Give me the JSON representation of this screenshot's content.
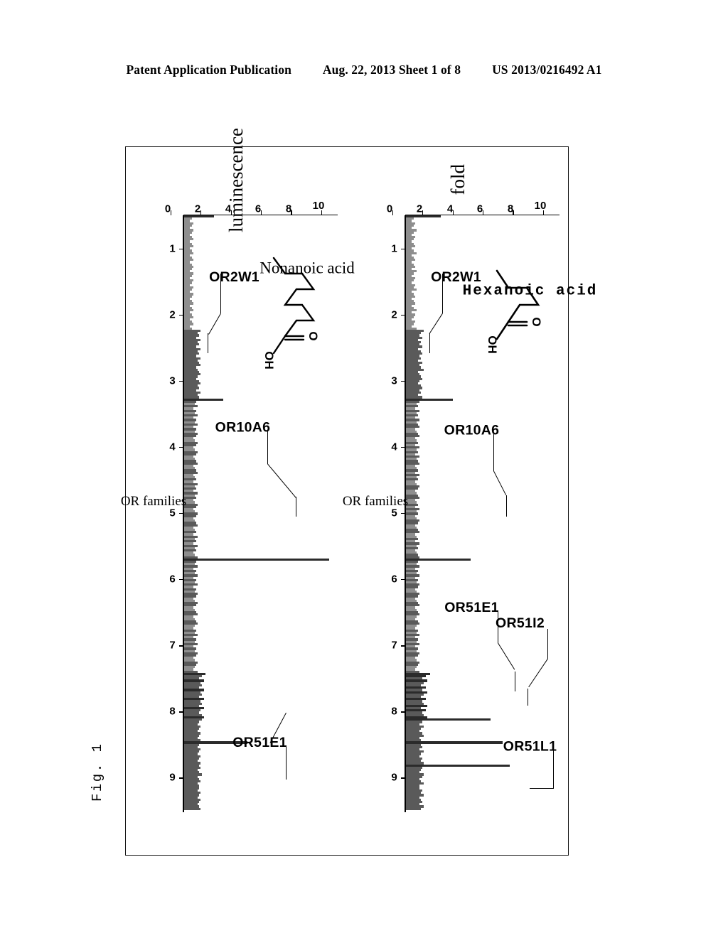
{
  "header": {
    "publication": "Patent Application Publication",
    "date_sheet": "Aug. 22, 2013  Sheet 1 of 8",
    "patent_number": "US 2013/0216492 A1"
  },
  "figure": {
    "label": "Fig. 1"
  },
  "axes": {
    "y_ticks": [
      "0",
      "2",
      "4",
      "6",
      "8",
      "10"
    ],
    "x_ticks": [
      "1",
      "2",
      "3",
      "4",
      "5",
      "6",
      "7",
      "8",
      "9"
    ],
    "x_title": "OR families",
    "y_title_part1": "fold",
    "y_title_part2": "luminescence"
  },
  "panels": [
    {
      "id": "hexanoic",
      "compound": "Hexanoic acid",
      "compound_font": "mono",
      "structure": {
        "carbonyl_label": "O",
        "hydroxyl_label": "OH",
        "chain_carbons": 6
      },
      "callouts": [
        {
          "label": "OR2W1"
        },
        {
          "label": "OR10A6"
        },
        {
          "label": "OR51E1"
        },
        {
          "label": "OR51I2"
        },
        {
          "label": "OR51L1"
        }
      ]
    },
    {
      "id": "nonanoic",
      "compound": "Nonanoic acid",
      "compound_font": "serif",
      "structure": {
        "carbonyl_label": "O",
        "hydroxyl_label": "OH",
        "chain_carbons": 9
      },
      "callouts": [
        {
          "label": "OR2W1"
        },
        {
          "label": "OR10A6"
        },
        {
          "label": "OR51E1"
        }
      ]
    }
  ],
  "chart_data": [
    {
      "type": "bar",
      "title": "Hexanoic acid",
      "xlabel": "OR families",
      "ylabel": "fold luminescence",
      "ylim": [
        0,
        10
      ],
      "xlim": [
        1,
        9
      ],
      "grid": false,
      "x_ticks": [
        1,
        2,
        3,
        4,
        5,
        6,
        7,
        8,
        9
      ],
      "y_ticks": [
        0,
        2,
        4,
        6,
        8,
        10
      ],
      "annotations": [
        {
          "label": "OR2W1",
          "x": 2.1,
          "y": 3.1
        },
        {
          "label": "OR10A6",
          "x": 5.0,
          "y": 4.3
        },
        {
          "label": "OR51E1",
          "x": 7.6,
          "y": 5.6
        },
        {
          "label": "OR51I2",
          "x": 7.8,
          "y": 6.4
        },
        {
          "label": "OR51L1",
          "x": 8.0,
          "y": 6.9
        }
      ],
      "values": [
        2.3,
        0.5,
        0.4,
        0.6,
        0.5,
        0.4,
        0.7,
        0.5,
        0.4,
        0.6,
        0.5,
        0.4,
        0.5,
        0.6,
        0.4,
        0.5,
        0.7,
        0.4,
        0.5,
        0.6,
        0.4,
        0.5,
        0.6,
        0.4,
        0.7,
        0.5,
        0.4,
        0.6,
        0.5,
        0.4,
        0.6,
        0.5,
        0.7,
        0.4,
        0.5,
        0.6,
        0.4,
        0.5,
        0.6,
        0.4,
        0.5,
        0.7,
        0.4,
        0.6,
        0.5,
        0.4,
        0.6,
        0.5,
        0.4,
        0.7,
        1.2,
        1.0,
        0.9,
        1.1,
        0.8,
        1.0,
        0.9,
        1.1,
        0.8,
        1.0,
        1.1,
        0.9,
        1.0,
        0.8,
        1.1,
        0.9,
        1.0,
        1.2,
        0.8,
        0.9,
        1.0,
        1.1,
        0.9,
        0.8,
        1.0,
        1.1,
        0.9,
        1.0,
        0.8,
        1.1,
        3.1,
        0.9,
        0.7,
        0.8,
        0.6,
        0.9,
        0.7,
        0.8,
        0.6,
        0.9,
        0.7,
        0.8,
        0.9,
        0.6,
        0.7,
        0.8,
        0.9,
        0.6,
        0.7,
        0.8,
        0.6,
        0.9,
        0.7,
        0.8,
        0.6,
        0.9,
        0.7,
        0.8,
        0.9,
        0.6,
        0.7,
        0.8,
        0.6,
        0.9,
        0.7,
        0.8,
        0.6,
        0.7,
        0.9,
        0.8,
        0.6,
        0.7,
        0.8,
        0.9,
        0.6,
        0.7,
        0.8,
        0.6,
        0.9,
        0.7,
        0.8,
        0.6,
        0.7,
        0.9,
        0.8,
        0.6,
        0.7,
        0.8,
        0.9,
        0.6,
        0.7,
        0.8,
        0.6,
        0.9,
        0.7,
        0.8,
        0.6,
        0.7,
        0.8,
        0.9,
        4.3,
        0.8,
        0.7,
        0.9,
        0.6,
        0.8,
        0.7,
        0.9,
        0.6,
        0.8,
        0.7,
        0.9,
        0.8,
        0.6,
        0.7,
        0.9,
        0.8,
        0.6,
        0.7,
        0.8,
        0.9,
        0.6,
        0.7,
        0.8,
        0.9,
        0.7,
        0.6,
        0.8,
        0.9,
        0.7,
        0.6,
        0.8,
        0.7,
        0.9,
        0.6,
        0.8,
        0.7,
        0.9,
        0.6,
        0.8,
        0.7,
        0.9,
        0.8,
        0.6,
        0.7,
        0.9,
        0.8,
        0.7,
        0.6,
        0.9,
        1.6,
        1.3,
        1.1,
        1.4,
        1.2,
        1.0,
        1.3,
        1.1,
        1.4,
        1.2,
        1.0,
        1.3,
        1.1,
        1.2,
        1.4,
        1.0,
        1.3,
        1.1,
        1.2,
        1.4,
        5.6,
        1.1,
        0.9,
        1.2,
        1.0,
        0.9,
        1.1,
        1.2,
        0.9,
        1.0,
        6.4,
        1.0,
        1.1,
        0.9,
        1.2,
        1.0,
        0.9,
        1.1,
        1.0,
        1.2,
        6.9,
        1.1,
        1.0,
        0.9,
        1.2,
        1.1,
        0.9,
        1.0,
        1.2,
        0.9,
        0.9,
        1.1,
        1.0,
        1.2,
        0.9,
        1.0,
        1.1,
        0.9,
        1.2,
        1.0
      ]
    },
    {
      "type": "bar",
      "title": "Nonanoic acid",
      "xlabel": "OR families",
      "ylabel": "fold luminescence",
      "ylim": [
        0,
        10
      ],
      "xlim": [
        1,
        9
      ],
      "grid": false,
      "x_ticks": [
        1,
        2,
        3,
        4,
        5,
        6,
        7,
        8,
        9
      ],
      "y_ticks": [
        0,
        2,
        4,
        6,
        8,
        10
      ],
      "annotations": [
        {
          "label": "OR2W1",
          "x": 2.1,
          "y": 2.6
        },
        {
          "label": "OR10A6",
          "x": 5.0,
          "y": 9.6
        },
        {
          "label": "OR51E1",
          "x": 7.8,
          "y": 4.2
        }
      ],
      "values": [
        2.0,
        0.5,
        0.4,
        0.6,
        0.5,
        0.4,
        0.6,
        0.5,
        0.4,
        0.5,
        0.6,
        0.4,
        0.5,
        0.6,
        0.4,
        0.5,
        0.6,
        0.4,
        0.5,
        0.6,
        0.4,
        0.5,
        0.6,
        0.5,
        0.4,
        0.6,
        0.5,
        0.4,
        0.6,
        0.5,
        0.4,
        0.6,
        0.5,
        0.4,
        0.6,
        0.5,
        0.4,
        0.5,
        0.6,
        0.4,
        0.5,
        0.6,
        0.4,
        0.5,
        0.6,
        0.4,
        0.5,
        0.6,
        0.4,
        0.5,
        1.1,
        0.9,
        1.0,
        0.8,
        1.1,
        0.9,
        1.0,
        0.8,
        1.1,
        0.9,
        1.0,
        0.8,
        1.1,
        0.9,
        1.0,
        1.1,
        0.8,
        0.9,
        1.0,
        1.1,
        0.9,
        0.8,
        1.0,
        1.1,
        0.9,
        1.0,
        0.8,
        1.1,
        0.9,
        1.0,
        2.6,
        0.8,
        0.7,
        0.9,
        0.6,
        0.8,
        0.7,
        0.9,
        0.6,
        0.8,
        0.7,
        0.9,
        0.6,
        0.8,
        0.7,
        0.9,
        0.8,
        0.6,
        0.7,
        0.9,
        0.8,
        0.6,
        0.7,
        0.9,
        0.8,
        0.6,
        0.7,
        0.8,
        0.9,
        0.6,
        0.7,
        0.8,
        0.9,
        0.6,
        0.7,
        0.8,
        0.6,
        0.9,
        0.7,
        0.8,
        0.6,
        0.9,
        0.7,
        0.8,
        0.6,
        0.7,
        0.9,
        0.8,
        0.6,
        0.7,
        0.9,
        0.8,
        0.6,
        0.7,
        0.8,
        0.9,
        0.6,
        0.7,
        0.8,
        0.6,
        0.9,
        0.7,
        0.8,
        0.6,
        0.9,
        0.7,
        0.8,
        0.6,
        0.7,
        0.9,
        9.6,
        0.8,
        0.7,
        0.9,
        0.6,
        0.8,
        0.7,
        0.9,
        0.6,
        0.8,
        0.7,
        0.9,
        0.6,
        0.8,
        0.7,
        0.9,
        0.8,
        0.6,
        0.7,
        0.9,
        0.8,
        0.6,
        0.7,
        0.8,
        0.9,
        0.6,
        0.7,
        0.8,
        0.9,
        0.7,
        0.6,
        0.8,
        0.7,
        0.9,
        0.6,
        0.8,
        0.7,
        0.9,
        0.6,
        0.8,
        0.7,
        0.9,
        0.8,
        0.6,
        0.7,
        0.9,
        0.8,
        0.7,
        0.6,
        0.9,
        1.4,
        1.2,
        1.0,
        1.3,
        1.1,
        1.2,
        1.0,
        1.3,
        1.1,
        1.2,
        1.0,
        1.3,
        1.1,
        1.2,
        1.0,
        1.3,
        1.1,
        1.0,
        1.2,
        1.3,
        1.2,
        1.0,
        0.9,
        1.1,
        1.0,
        0.9,
        1.1,
        1.0,
        0.9,
        1.1,
        4.2,
        1.0,
        0.9,
        1.1,
        1.0,
        0.9,
        1.1,
        1.0,
        0.9,
        1.1,
        1.0,
        1.1,
        0.9,
        1.0,
        1.2,
        0.9,
        1.0,
        1.1,
        0.9,
        1.0,
        1.0,
        0.9,
        1.1,
        1.0,
        0.9,
        1.1,
        1.0,
        0.9,
        1.0,
        1.1
      ]
    }
  ]
}
